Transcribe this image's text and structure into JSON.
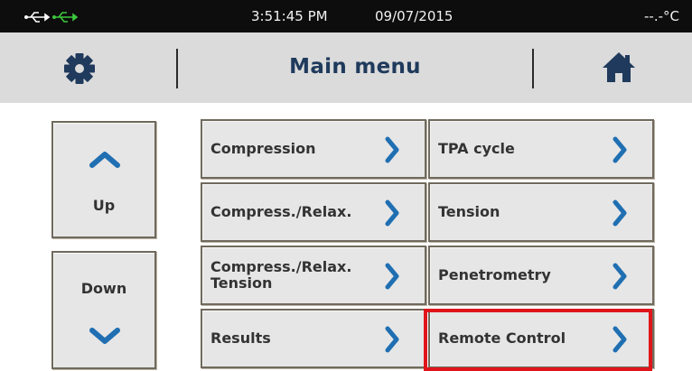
{
  "status_bar": {
    "time": "3:51:45 PM",
    "date": "09/07/2015",
    "temperature": "--.-°C",
    "icons": [
      "usb-connection-icon",
      "usb-active-icon"
    ]
  },
  "header": {
    "title": "Main menu",
    "left_icon": "gear-icon",
    "right_icon": "home-icon"
  },
  "navigation": {
    "up_label": "Up",
    "down_label": "Down"
  },
  "menu": {
    "items": [
      {
        "lines": [
          "Compression"
        ]
      },
      {
        "lines": [
          "TPA cycle"
        ]
      },
      {
        "lines": [
          "Compress./Relax."
        ]
      },
      {
        "lines": [
          "Tension"
        ]
      },
      {
        "lines": [
          "Compress./Relax.",
          "Tension"
        ]
      },
      {
        "lines": [
          "Penetrometry"
        ]
      },
      {
        "lines": [
          "Results"
        ]
      },
      {
        "lines": [
          "Remote Control"
        ]
      }
    ],
    "highlighted_item": "Remote Control"
  },
  "colors": {
    "title": "#1f3a5c",
    "accent_arrow": "#1f6fb2",
    "highlight": "#e0151b",
    "usb_active": "#3cc83c"
  }
}
